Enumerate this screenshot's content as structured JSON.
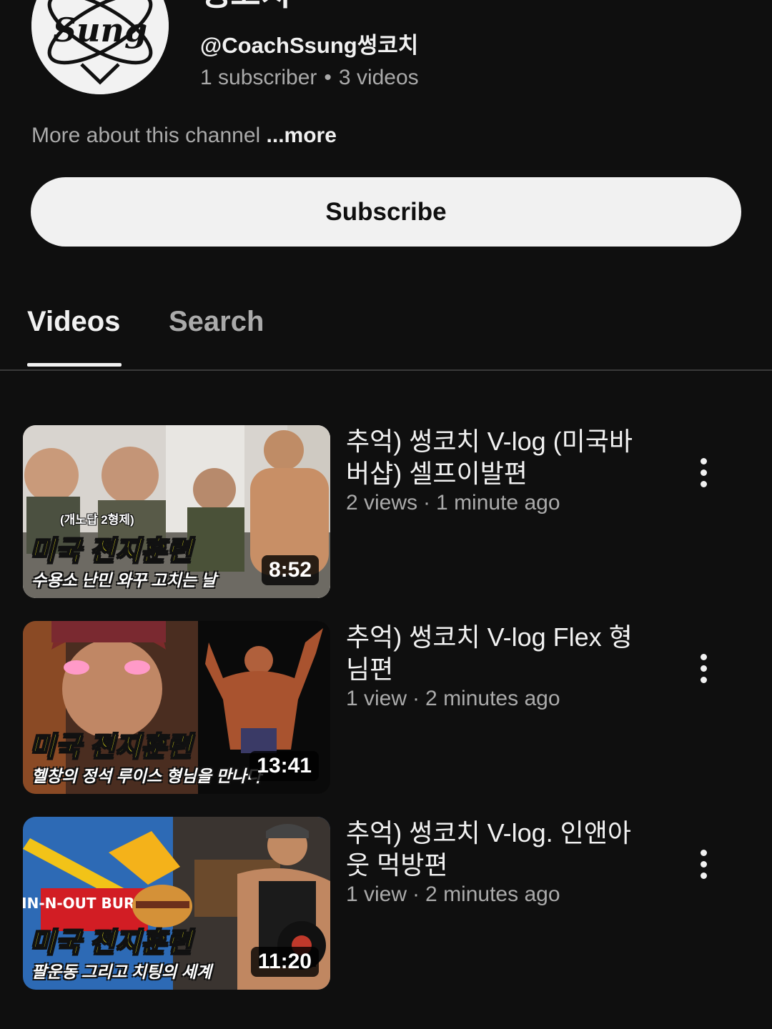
{
  "channel": {
    "name": "썽코치",
    "handle": "@CoachSsung썽코치",
    "subscribers": "1 subscriber",
    "videos_count": "3 videos",
    "separator": "•",
    "about": "More about this channel",
    "about_more": "...more",
    "avatar_logo_text": "Sung"
  },
  "subscribe": {
    "label": "Subscribe"
  },
  "tabs": [
    {
      "label": "Videos",
      "active": true
    },
    {
      "label": "Search",
      "active": false
    }
  ],
  "videos": [
    {
      "title": "추억) 썽코치 V-log (미국바버샵) 셀프이발편",
      "views": "2 views",
      "age": "1 minute ago",
      "duration": "8:52",
      "thumb_tag": "(개노답 2형제)",
      "thumb_title": "미국 전지훈련",
      "thumb_subtitle": "수용소 난민 와꾸 고치는 날"
    },
    {
      "title": "추억) 썽코치 V-log Flex 형님편",
      "views": "1 view",
      "age": "2 minutes ago",
      "duration": "13:41",
      "thumb_title": "미국 전지훈련",
      "thumb_subtitle": "헬창의 정석 루이스 형님을 만나다"
    },
    {
      "title": "추억) 썽코치 V-log. 인앤아웃 먹방편",
      "views": "1 view",
      "age": "2 minutes ago",
      "duration": "11:20",
      "thumb_sign": "IN-N-OUT BURGER",
      "thumb_title": "미국 전지훈련",
      "thumb_subtitle": "팔운동 그리고 치팅의 세계"
    }
  ],
  "meta_separator": "·",
  "colors": {
    "background": "#0f0f0f",
    "text_primary": "#f1f1f1",
    "text_secondary": "#aaaaaa",
    "subscribe_bg": "#f1f1f1",
    "thumb_title_yellow": "#f4f01a"
  }
}
